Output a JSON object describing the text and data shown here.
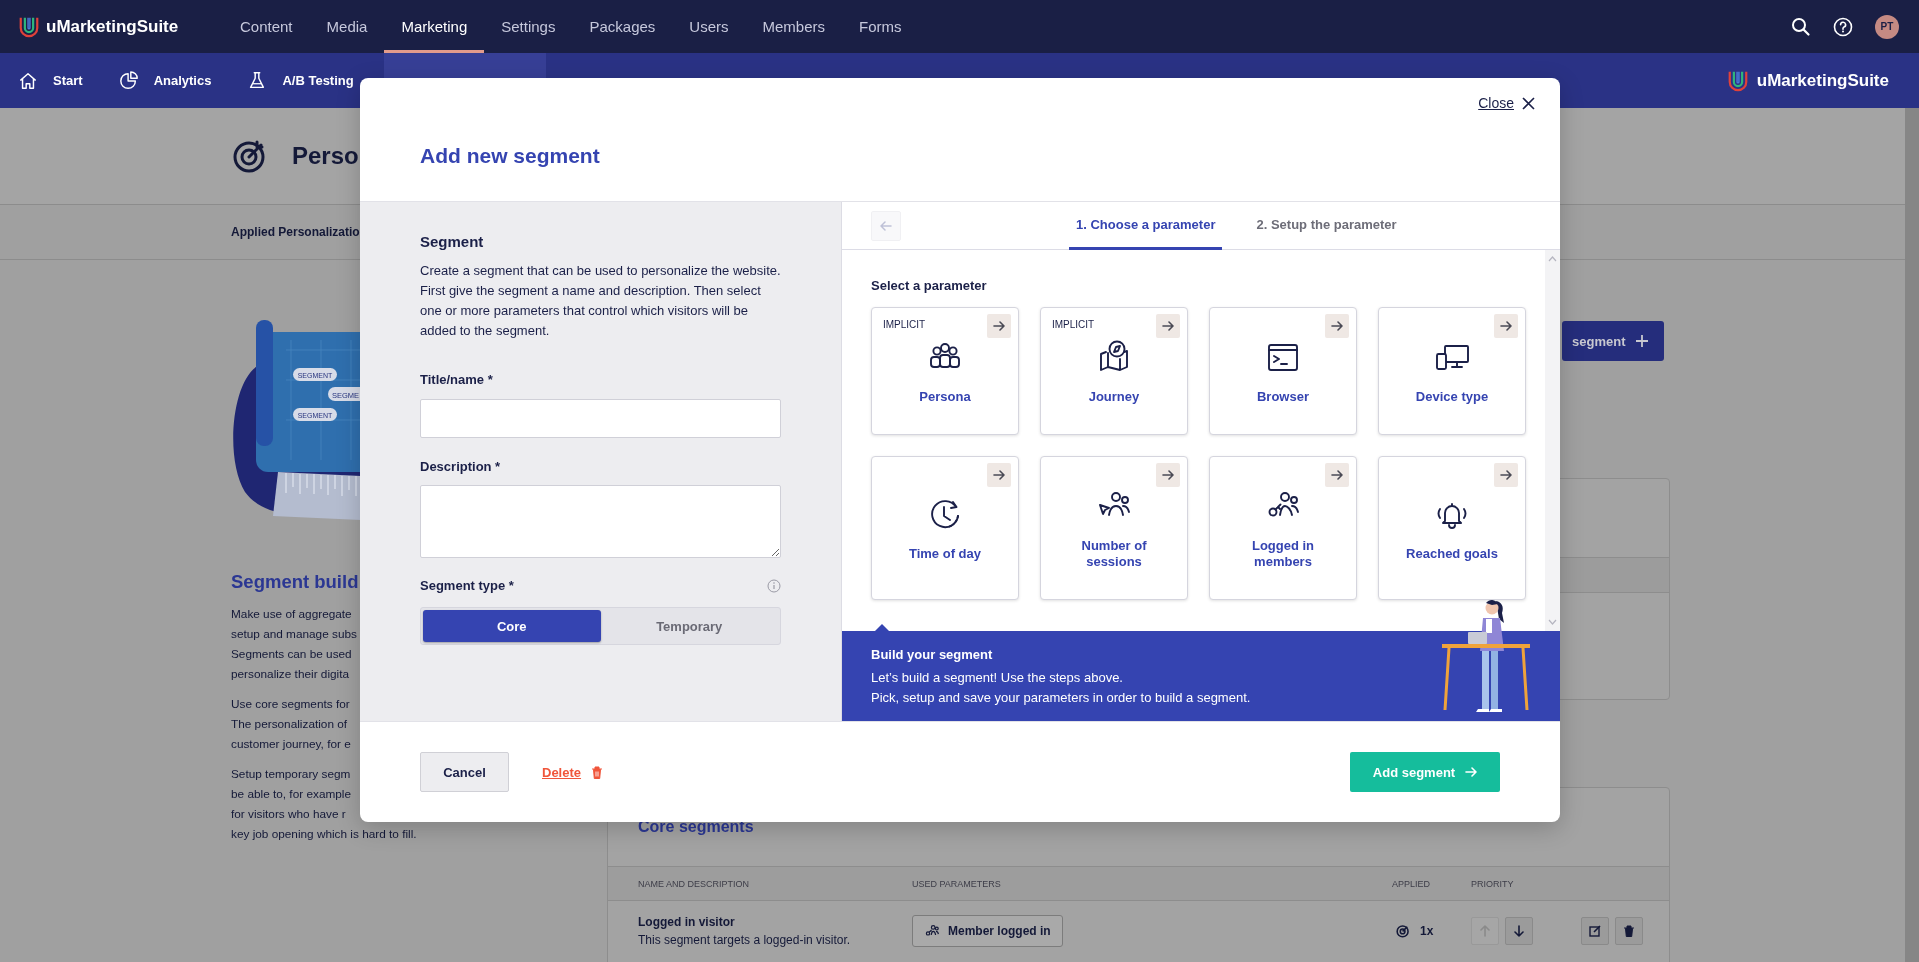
{
  "top_nav": {
    "brand": "uMarketingSuite",
    "avatar": "PT",
    "items": [
      {
        "label": "Content",
        "selected": false
      },
      {
        "label": "Media",
        "selected": false
      },
      {
        "label": "Marketing",
        "selected": true
      },
      {
        "label": "Settings",
        "selected": false
      },
      {
        "label": "Packages",
        "selected": false
      },
      {
        "label": "Users",
        "selected": false
      },
      {
        "label": "Members",
        "selected": false
      },
      {
        "label": "Forms",
        "selected": false
      }
    ]
  },
  "sub_nav": {
    "brand": "uMarketingSuite",
    "items": [
      {
        "label": "Start",
        "selected": false
      },
      {
        "label": "Analytics",
        "selected": false
      },
      {
        "label": "A/B Testing",
        "selected": false
      },
      {
        "selected": true
      }
    ]
  },
  "page": {
    "title": "Perso",
    "applied_tab": "Applied Personalizatio",
    "illustration_labels": [
      "SEGMENT",
      "SEGME",
      "SEGMENT"
    ],
    "heading": "Segment build",
    "paragraphs": [
      [
        "Make use of aggregate",
        "setup and manage subs",
        "Segments can be used",
        "personalize their digita"
      ],
      [
        "Use core segments for",
        "The personalization of",
        "customer journey, for e"
      ],
      [
        "Setup temporary segm",
        "be able to, for example",
        "for visitors who have r",
        "key job opening which is hard to fill."
      ]
    ],
    "new_segment_button": "segment",
    "core_segments": {
      "title": "Core segments",
      "columns": [
        "NAME AND DESCRIPTION",
        "USED PARAMETERS",
        "APPLIED",
        "PRIORITY"
      ],
      "rows": [
        {
          "name": "Logged in visitor",
          "description": "This segment targets a logged-in visitor.",
          "parameter": "Member logged in",
          "applied": "1x",
          "move_up_disabled": true,
          "move_down_disabled": false
        }
      ]
    }
  },
  "modal": {
    "close": "Close",
    "title": "Add new segment",
    "form": {
      "heading": "Segment",
      "intro": "Create a segment that can be used to personalize the website. First give the segment a name and description. Then select one or more parameters that control which visitors will be added to the segment.",
      "fields": [
        {
          "label": "Title/name *",
          "kind": "text"
        },
        {
          "label": "Description *",
          "kind": "textarea"
        }
      ],
      "segment_type": {
        "label": "Segment type *",
        "options": [
          {
            "label": "Core",
            "selected": true
          },
          {
            "label": "Temporary",
            "selected": false
          }
        ]
      }
    },
    "back_button": {
      "disabled": true
    },
    "steps": [
      {
        "label": "1. Choose a parameter",
        "selected": true
      },
      {
        "label": "2. Setup the parameter",
        "selected": false
      }
    ],
    "parameters": {
      "heading": "Select a parameter",
      "items": [
        {
          "label": "Persona",
          "tag": "IMPLICIT"
        },
        {
          "label": "Journey",
          "tag": "IMPLICIT"
        },
        {
          "label": "Browser"
        },
        {
          "label": "Device type"
        },
        {
          "label": "Time of day"
        },
        {
          "label": "Number of sessions"
        },
        {
          "label": "Logged in members"
        },
        {
          "label": "Reached goals"
        }
      ]
    },
    "banner": {
      "title": "Build your segment",
      "lines": [
        "Let’s build a segment! Use the steps above.",
        "Pick, setup and save your parameters in order to build a segment."
      ]
    },
    "footer": {
      "cancel": "Cancel",
      "delete": "Delete",
      "submit": "Add segment"
    }
  }
}
